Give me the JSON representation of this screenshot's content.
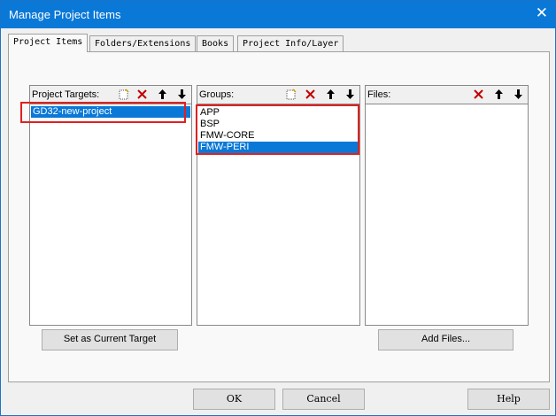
{
  "window": {
    "title": "Manage Project Items",
    "close_glyph": "✕"
  },
  "tabs": [
    {
      "label": "Project Items",
      "active": true
    },
    {
      "label": "Folders/Extensions",
      "active": false
    },
    {
      "label": "Books",
      "active": false
    },
    {
      "label": "Project Info/Layer",
      "active": false
    }
  ],
  "targets": {
    "header": "Project Targets:",
    "items": [
      "GD32-new-project"
    ],
    "selected_index": 0,
    "button_label": "Set as Current Target"
  },
  "groups": {
    "header": "Groups:",
    "items": [
      "APP",
      "BSP",
      "FMW-CORE",
      "FMW-PERI"
    ],
    "selected_index": 3
  },
  "files": {
    "header": "Files:",
    "items": [],
    "button_label": "Add Files..."
  },
  "footer": {
    "ok": "OK",
    "cancel": "Cancel",
    "help": "Help"
  },
  "icons": {
    "new": "new-item-icon",
    "delete": "delete-x-icon",
    "up": "move-up-arrow-icon",
    "down": "move-down-arrow-icon"
  },
  "colors": {
    "titlebar": "#0a78d7",
    "selection": "#0a78d7",
    "highlight_box": "#e02020",
    "delete_icon": "#c00000"
  }
}
